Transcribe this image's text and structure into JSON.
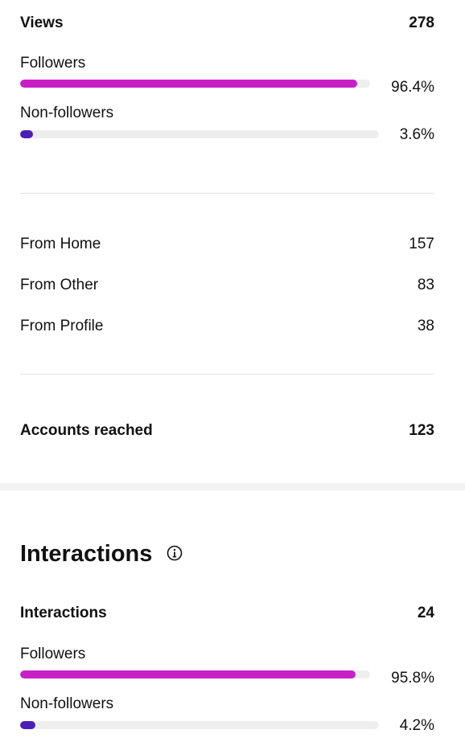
{
  "views": {
    "label": "Views",
    "value": "278",
    "breakdown": [
      {
        "label": "Followers",
        "percent_text": "96.4%",
        "fraction": 0.964,
        "color": "#c81fc6"
      },
      {
        "label": "Non-followers",
        "percent_text": "3.6%",
        "fraction": 0.036,
        "color": "#4b1fb5"
      }
    ]
  },
  "sources": [
    {
      "label": "From Home",
      "value": "157"
    },
    {
      "label": "From Other",
      "value": "83"
    },
    {
      "label": "From Profile",
      "value": "38"
    }
  ],
  "accounts_reached": {
    "label": "Accounts reached",
    "value": "123"
  },
  "interactions": {
    "title": "Interactions",
    "info_icon": "info-icon",
    "label": "Interactions",
    "value": "24",
    "breakdown": [
      {
        "label": "Followers",
        "percent_text": "95.8%",
        "fraction": 0.958,
        "color": "#c81fc6"
      },
      {
        "label": "Non-followers",
        "percent_text": "4.2%",
        "fraction": 0.042,
        "color": "#4b1fb5"
      }
    ]
  }
}
